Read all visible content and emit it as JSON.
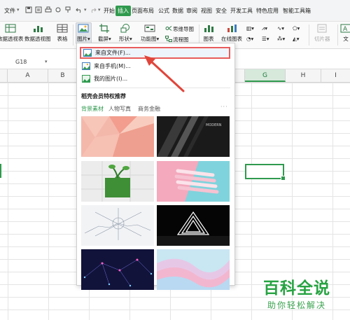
{
  "menubar": {
    "file_label": "文件",
    "tabs": [
      "开始",
      "插入",
      "页面布局",
      "公式",
      "数据",
      "审阅",
      "视图",
      "安全",
      "开发工具",
      "特色应用",
      "智能工具箱"
    ],
    "active_tab": "插入"
  },
  "ribbon": {
    "pivot_table": "数据透视表",
    "pivot_chart": "数据透视图",
    "table": "表格",
    "picture": "图片",
    "screenshot": "截屏",
    "shapes": "形状",
    "function_chart": "功能图",
    "mind_map": "思维导图",
    "flowchart": "流程图",
    "all_charts": "图表",
    "online_charts": "在线图表",
    "slicer": "切片器",
    "text": "文"
  },
  "formula_bar": {
    "cell_name": "G18"
  },
  "grid": {
    "columns": [
      "A",
      "B",
      "C",
      "D",
      "E",
      "F",
      "G",
      "H",
      "I"
    ],
    "selected_column": "G"
  },
  "picture_menu": {
    "items": [
      {
        "label": "来自文件(F)...",
        "icon": "picture-file-icon",
        "highlighted": true
      },
      {
        "label": "来自手机(M)...",
        "icon": "phone-icon",
        "highlighted": false
      },
      {
        "label": "我的图片(I)...",
        "icon": "my-pictures-icon",
        "highlighted": false
      }
    ],
    "section_title": "稻壳会员特权推荐",
    "tabs": [
      "背景素材",
      "人物写真",
      "商务金融"
    ],
    "active_tab": "背景素材",
    "more": "···",
    "thumbnails": [
      {
        "name": "pink-geometric",
        "caption": ""
      },
      {
        "name": "black-modern",
        "caption": "MODERN"
      },
      {
        "name": "green-puzzle-plant",
        "caption": ""
      },
      {
        "name": "pink-cyan-pencils",
        "caption": ""
      },
      {
        "name": "tech-sketch-hands",
        "caption": ""
      },
      {
        "name": "neon-triangle",
        "caption": ""
      },
      {
        "name": "purple-network",
        "caption": ""
      },
      {
        "name": "pastel-waves",
        "caption": ""
      }
    ]
  },
  "colors": {
    "accent": "#2f9a4e",
    "highlight_box": "#e85c5c",
    "watermark": "#27a342"
  },
  "watermark": {
    "title": "百科全说",
    "subtitle": "助你轻松解决"
  }
}
